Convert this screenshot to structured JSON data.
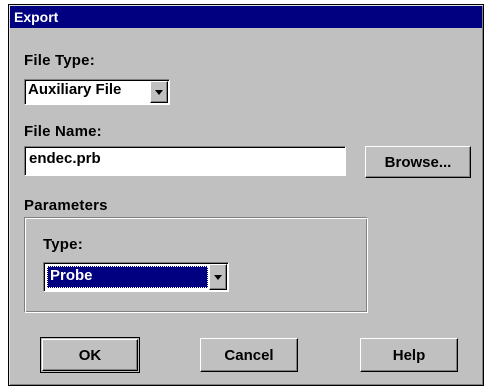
{
  "dialog": {
    "title": "Export"
  },
  "file_type": {
    "label": "File Type:",
    "value": "Auxiliary File"
  },
  "file_name": {
    "label": "File Name:",
    "value": "endec.prb",
    "browse_label": "Browse..."
  },
  "parameters": {
    "group_label": "Parameters",
    "type_label": "Type:",
    "type_value": "Probe"
  },
  "buttons": {
    "ok": "OK",
    "cancel": "Cancel",
    "help": "Help"
  },
  "icons": {
    "dropdown": "chevron-down-icon"
  }
}
